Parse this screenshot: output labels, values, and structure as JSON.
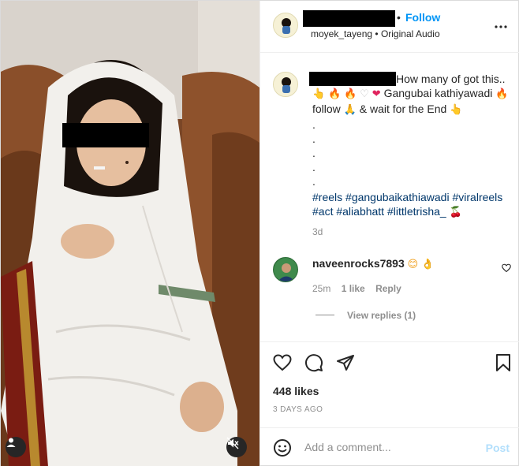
{
  "header": {
    "follow_label": "Follow",
    "username": "moyek_tayeng",
    "separator": "•",
    "audio_label": "Original Audio"
  },
  "caption": {
    "text_start": "How many of got this..",
    "line2_text": "Gangubai kathiyawadi",
    "line3_follow": "follow",
    "line3_rest": "& wait for the End",
    "dots": [
      ".",
      ".",
      ".",
      ".",
      "."
    ],
    "hashtags_line1": [
      "#reels",
      "#gangubaikathiawadi",
      "#viralreels"
    ],
    "hashtags_line2": [
      "#act",
      "#aliabhatt",
      "#littletrisha_"
    ],
    "time": "3d"
  },
  "comment": {
    "username": "naveenrocks7893",
    "time": "25m",
    "likes": "1 like",
    "reply_label": "Reply",
    "view_replies": "View replies (1)"
  },
  "actions": {
    "likes": "448 likes",
    "date": "3 DAYS AGO"
  },
  "add_comment": {
    "placeholder": "Add a comment...",
    "post_label": "Post"
  },
  "icons": {
    "heart": "heart-icon",
    "comment": "comment-icon",
    "share": "share-icon",
    "bookmark": "bookmark-icon",
    "emoji": "emoji-icon",
    "more": "more-options-icon",
    "mute": "mute-icon",
    "user": "user-tag-icon"
  },
  "colors": {
    "link_blue": "#0095f6",
    "hashtag": "#00376b",
    "muted": "#8e8e8e",
    "post_disabled": "#b2dffc"
  }
}
